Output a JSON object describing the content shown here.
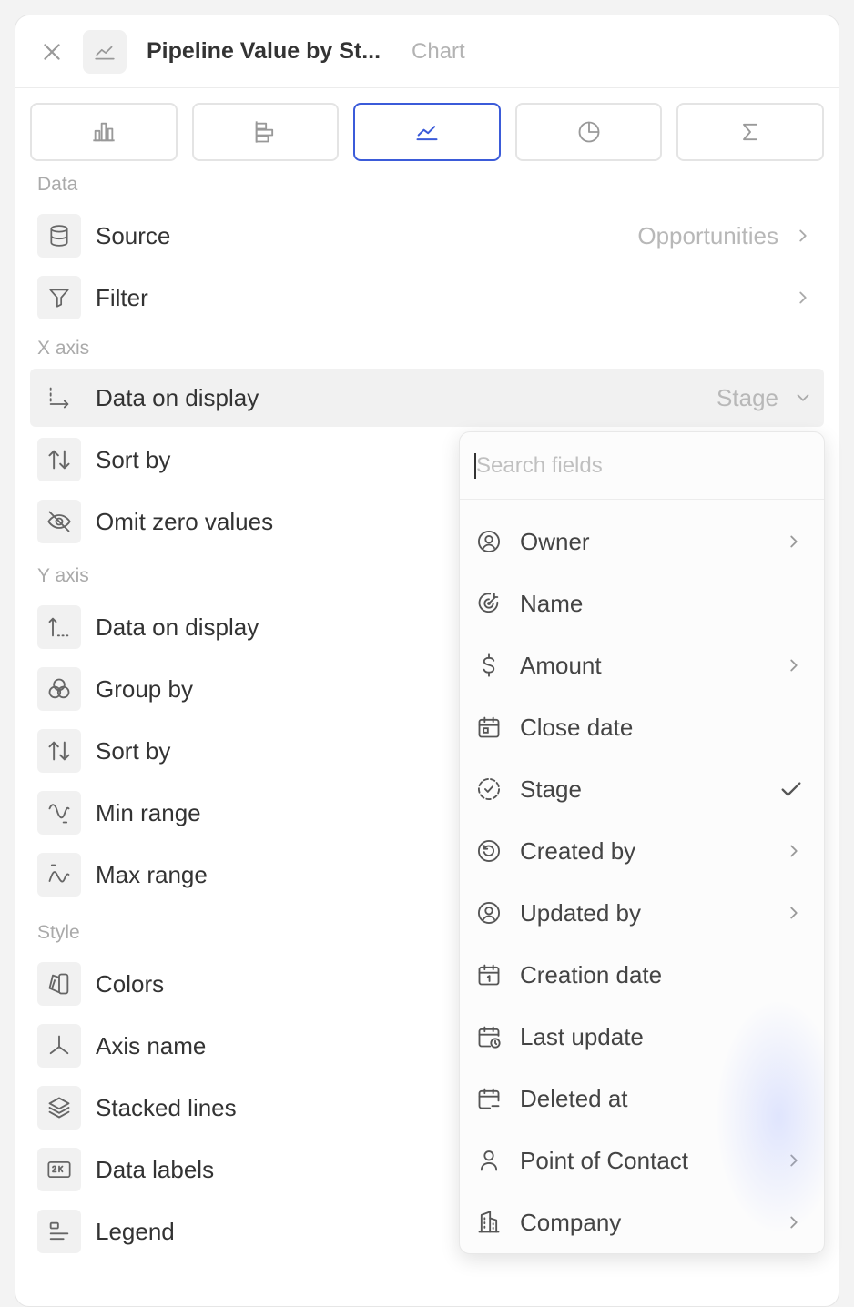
{
  "header": {
    "title": "Pipeline Value by St...",
    "subtitle": "Chart"
  },
  "chart_types": [
    {
      "icon": "bar-chart-icon",
      "active": false
    },
    {
      "icon": "horizontal-bar-chart-icon",
      "active": false
    },
    {
      "icon": "line-chart-icon",
      "active": true
    },
    {
      "icon": "pie-chart-icon",
      "active": false
    },
    {
      "icon": "sigma-icon",
      "active": false
    }
  ],
  "sections": {
    "data": {
      "label": "Data",
      "source": {
        "label": "Source",
        "value": "Opportunities"
      },
      "filter": {
        "label": "Filter"
      }
    },
    "x_axis": {
      "label": "X axis",
      "data_on_display": {
        "label": "Data on display",
        "value": "Stage"
      },
      "sort_by": {
        "label": "Sort by"
      },
      "omit_zero": {
        "label": "Omit zero values"
      }
    },
    "y_axis": {
      "label": "Y axis",
      "data_on_display": {
        "label": "Data on display"
      },
      "group_by": {
        "label": "Group by"
      },
      "sort_by": {
        "label": "Sort by"
      },
      "min_range": {
        "label": "Min range"
      },
      "max_range": {
        "label": "Max range"
      }
    },
    "style": {
      "label": "Style",
      "colors": {
        "label": "Colors"
      },
      "axis_name": {
        "label": "Axis name"
      },
      "stacked_lines": {
        "label": "Stacked lines"
      },
      "data_labels": {
        "label": "Data labels"
      },
      "legend": {
        "label": "Legend"
      }
    }
  },
  "dropdown": {
    "search_placeholder": "Search fields",
    "items": [
      {
        "label": "Owner",
        "icon": "user-circle-icon",
        "right": "chevron"
      },
      {
        "label": "Name",
        "icon": "target-icon",
        "right": ""
      },
      {
        "label": "Amount",
        "icon": "dollar-icon",
        "right": "chevron"
      },
      {
        "label": "Close date",
        "icon": "calendar-icon",
        "right": ""
      },
      {
        "label": "Stage",
        "icon": "progress-check-icon",
        "right": "check"
      },
      {
        "label": "Created by",
        "icon": "history-icon",
        "right": "chevron"
      },
      {
        "label": "Updated by",
        "icon": "user-circle-icon",
        "right": "chevron"
      },
      {
        "label": "Creation date",
        "icon": "calendar-1-icon",
        "right": ""
      },
      {
        "label": "Last update",
        "icon": "calendar-clock-icon",
        "right": ""
      },
      {
        "label": "Deleted at",
        "icon": "calendar-minus-icon",
        "right": ""
      },
      {
        "label": "Point of Contact",
        "icon": "user-icon",
        "right": "chevron"
      },
      {
        "label": "Company",
        "icon": "building-icon",
        "right": "chevron"
      }
    ]
  },
  "colors": {
    "accent": "#3b5bd9",
    "muted_text": "#b3b3b3",
    "icon_bg": "#f1f1f1"
  }
}
